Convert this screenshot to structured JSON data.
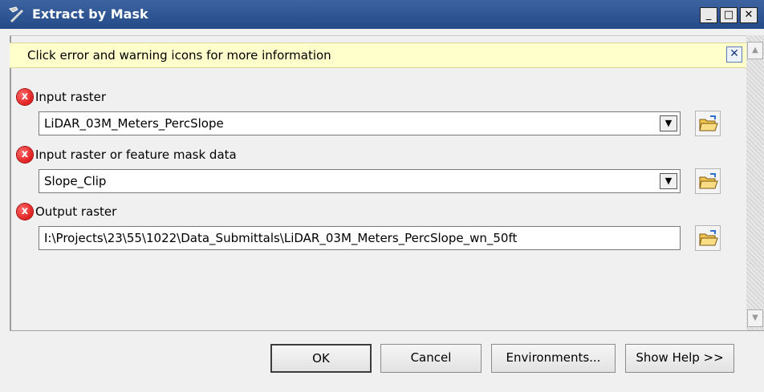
{
  "window": {
    "title": "Extract by Mask",
    "minimize_label": "_",
    "maximize_label": "□",
    "close_label": "✕"
  },
  "message_bar": {
    "text": "Click error and warning icons for more information",
    "close_label": "✕"
  },
  "parameters": [
    {
      "label": "Input raster",
      "value": "LiDAR_03M_Meters_PercSlope",
      "has_dropdown": true,
      "status": "error"
    },
    {
      "label": "Input raster or feature mask data",
      "value": "Slope_Clip",
      "has_dropdown": true,
      "status": "error"
    },
    {
      "label": "Output raster",
      "value": "I:\\Projects\\23\\55\\1022\\Data_Submittals\\LiDAR_03M_Meters_PercSlope_wn_50ft",
      "has_dropdown": false,
      "status": "error"
    }
  ],
  "buttons": {
    "ok": "OK",
    "cancel": "Cancel",
    "environments": "Environments...",
    "show_help": "Show Help >>"
  },
  "icons": {
    "error": "x",
    "dropdown": "▼",
    "scroll_up": "▲",
    "scroll_down": "▼"
  },
  "colors": {
    "titlebar": "#2f5896",
    "message_bar_bg": "#ffffcc",
    "error_icon": "#d40000",
    "folder_icon": "#f5d36b"
  }
}
